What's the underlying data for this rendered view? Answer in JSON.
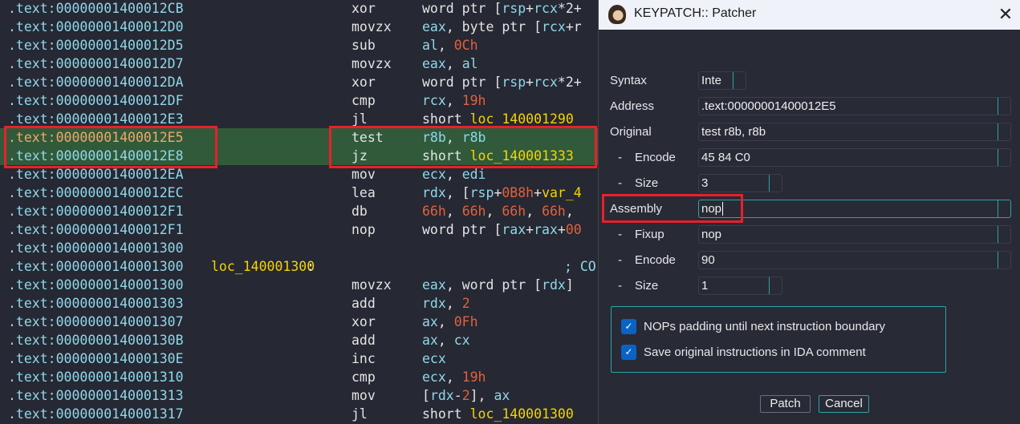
{
  "listing": {
    "rows": [
      {
        "addr": ".text:00000001400012CB",
        "mn": "xor",
        "op": [
          [
            "c-txt",
            "word ptr ["
          ],
          [
            "c-reg",
            "rsp"
          ],
          [
            "c-txt",
            "+"
          ],
          [
            "c-reg",
            "rcx"
          ],
          [
            "c-txt",
            "*2+"
          ]
        ]
      },
      {
        "addr": ".text:00000001400012D0",
        "mn": "movzx",
        "op": [
          [
            "c-reg",
            "eax"
          ],
          [
            "c-txt",
            ", byte ptr ["
          ],
          [
            "c-reg",
            "rcx"
          ],
          [
            "c-txt",
            "+r"
          ]
        ]
      },
      {
        "addr": ".text:00000001400012D5",
        "mn": "sub",
        "op": [
          [
            "c-reg",
            "al"
          ],
          [
            "c-txt",
            ", "
          ],
          [
            "c-num",
            "0Ch"
          ]
        ]
      },
      {
        "addr": ".text:00000001400012D7",
        "mn": "movzx",
        "op": [
          [
            "c-reg",
            "eax"
          ],
          [
            "c-txt",
            ", "
          ],
          [
            "c-reg",
            "al"
          ]
        ]
      },
      {
        "addr": ".text:00000001400012DA",
        "mn": "xor",
        "op": [
          [
            "c-txt",
            "word ptr ["
          ],
          [
            "c-reg",
            "rsp"
          ],
          [
            "c-txt",
            "+"
          ],
          [
            "c-reg",
            "rcx"
          ],
          [
            "c-txt",
            "*2+"
          ]
        ]
      },
      {
        "addr": ".text:00000001400012DF",
        "mn": "cmp",
        "op": [
          [
            "c-reg",
            "rcx"
          ],
          [
            "c-txt",
            ", "
          ],
          [
            "c-num",
            "19h"
          ]
        ]
      },
      {
        "addr": ".text:00000001400012E3",
        "mn": "jl",
        "op": [
          [
            "c-txt",
            "short "
          ],
          [
            "c-lbl",
            "loc 140001290"
          ]
        ]
      },
      {
        "addr": ".text:00000001400012E5",
        "mn": "test",
        "op": [
          [
            "c-reg",
            "r8b"
          ],
          [
            "c-txt",
            ", "
          ],
          [
            "c-reg",
            "r8b"
          ]
        ],
        "highlight": true,
        "current": true
      },
      {
        "addr": ".text:00000001400012E8",
        "mn": "jz",
        "op": [
          [
            "c-txt",
            "short "
          ],
          [
            "c-lbl",
            "loc_140001333"
          ]
        ],
        "highlight": true
      },
      {
        "addr": ".text:00000001400012EA",
        "mn": "mov",
        "op": [
          [
            "c-reg",
            "ecx"
          ],
          [
            "c-txt",
            ", "
          ],
          [
            "c-reg",
            "edi"
          ]
        ]
      },
      {
        "addr": ".text:00000001400012EC",
        "mn": "lea",
        "op": [
          [
            "c-reg",
            "rdx"
          ],
          [
            "c-txt",
            ", ["
          ],
          [
            "c-reg",
            "rsp"
          ],
          [
            "c-txt",
            "+"
          ],
          [
            "c-num",
            "0B8h"
          ],
          [
            "c-txt",
            "+"
          ],
          [
            "c-lbl",
            "var_4"
          ]
        ]
      },
      {
        "addr": ".text:00000001400012F1",
        "mn": "db",
        "op": [
          [
            "c-num",
            "66h"
          ],
          [
            "c-txt",
            ", "
          ],
          [
            "c-num",
            "66h"
          ],
          [
            "c-txt",
            ", "
          ],
          [
            "c-num",
            "66h"
          ],
          [
            "c-txt",
            ", "
          ],
          [
            "c-num",
            "66h"
          ],
          [
            "c-txt",
            ","
          ]
        ]
      },
      {
        "addr": ".text:00000001400012F1",
        "mn": "nop",
        "op": [
          [
            "c-txt",
            "word ptr ["
          ],
          [
            "c-reg",
            "rax"
          ],
          [
            "c-txt",
            "+"
          ],
          [
            "c-reg",
            "rax"
          ],
          [
            "c-txt",
            "+"
          ],
          [
            "c-num",
            "00"
          ]
        ]
      },
      {
        "addr": ".text:0000000140001300",
        "mn": "",
        "op": []
      },
      {
        "addr": ".text:0000000140001300",
        "label": "loc_140001300",
        "label_suffix": ":",
        "comment": "; CO",
        "mn": "",
        "op": []
      },
      {
        "addr": ".text:0000000140001300",
        "mn": "movzx",
        "op": [
          [
            "c-reg",
            "eax"
          ],
          [
            "c-txt",
            ", word ptr ["
          ],
          [
            "c-reg",
            "rdx"
          ],
          [
            "c-txt",
            "]"
          ]
        ]
      },
      {
        "addr": ".text:0000000140001303",
        "mn": "add",
        "op": [
          [
            "c-reg",
            "rdx"
          ],
          [
            "c-txt",
            ", "
          ],
          [
            "c-num",
            "2"
          ]
        ]
      },
      {
        "addr": ".text:0000000140001307",
        "mn": "xor",
        "op": [
          [
            "c-reg",
            "ax"
          ],
          [
            "c-txt",
            ", "
          ],
          [
            "c-num",
            "0Fh"
          ]
        ]
      },
      {
        "addr": ".text:000000014000130B",
        "mn": "add",
        "op": [
          [
            "c-reg",
            "ax"
          ],
          [
            "c-txt",
            ", "
          ],
          [
            "c-reg",
            "cx"
          ]
        ]
      },
      {
        "addr": ".text:000000014000130E",
        "mn": "inc",
        "op": [
          [
            "c-reg",
            "ecx"
          ]
        ]
      },
      {
        "addr": ".text:0000000140001310",
        "mn": "cmp",
        "op": [
          [
            "c-reg",
            "ecx"
          ],
          [
            "c-txt",
            ", "
          ],
          [
            "c-num",
            "19h"
          ]
        ]
      },
      {
        "addr": ".text:0000000140001313",
        "mn": "mov",
        "op": [
          [
            "c-txt",
            "["
          ],
          [
            "c-reg",
            "rdx"
          ],
          [
            "c-txt",
            "-"
          ],
          [
            "c-num",
            "2"
          ],
          [
            "c-txt",
            "], "
          ],
          [
            "c-reg",
            "ax"
          ]
        ]
      },
      {
        "addr": ".text:0000000140001317",
        "mn": "jl",
        "op": [
          [
            "c-txt",
            "short "
          ],
          [
            "c-lbl",
            "loc_140001300"
          ]
        ]
      }
    ]
  },
  "dialog": {
    "title": "KEYPATCH:: Patcher",
    "close": "✕",
    "fields": {
      "syntax_label": "Syntax",
      "syntax_value": "Inte",
      "address_label": "Address",
      "address_value": ".text:00000001400012E5",
      "original_label": "Original",
      "original_value": "test r8b, r8b",
      "orig_encode_label": "Encode",
      "orig_encode_value": "45 84 C0",
      "orig_size_label": "Size",
      "orig_size_value": "3",
      "assembly_label": "Assembly",
      "assembly_value": "nop",
      "fixup_label": "Fixup",
      "fixup_value": "nop",
      "new_encode_label": "Encode",
      "new_encode_value": "90",
      "new_size_label": "Size",
      "new_size_value": "1",
      "dash": "-"
    },
    "options": [
      {
        "label": "NOPs padding until next instruction boundary",
        "checked": true
      },
      {
        "label": "Save original instructions in IDA comment",
        "checked": true
      }
    ],
    "buttons": {
      "patch": "Patch",
      "cancel": "Cancel"
    }
  },
  "colors": {
    "highlight": "#315a3b",
    "annotation_box": "#e8202a",
    "accent": "#2aa5a5",
    "checkbox": "#0a63c4"
  }
}
